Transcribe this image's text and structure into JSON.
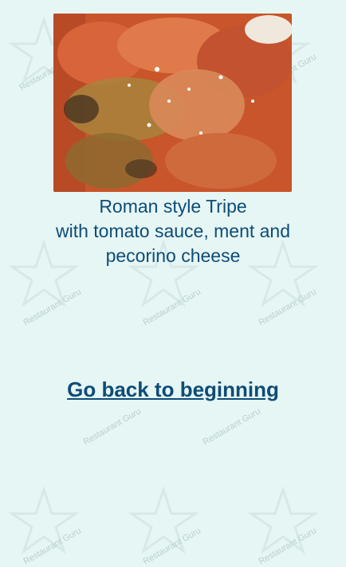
{
  "menu_item": {
    "image_alt": "Roman style Tripe dish photo",
    "title_line1": "Roman style Tripe",
    "title_line2": "with tomato sauce, ment and",
    "title_line3": "pecorino cheese"
  },
  "navigation": {
    "back_link": "Go back to beginning"
  },
  "watermark": {
    "text": "Restaurant Guru",
    "icon": "fork-star-icon"
  },
  "colors": {
    "background": "#e6f6f4",
    "text": "#0d4c78"
  }
}
